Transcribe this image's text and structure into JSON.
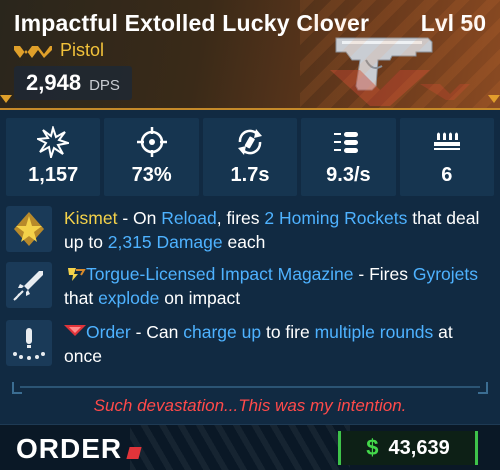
{
  "item": {
    "name": "Impactful Extolled Lucky Clover",
    "level": "Lvl 50",
    "weapon_type": "Pistol",
    "dps_value": "2,948",
    "dps_label": "DPS",
    "rarity_color": "#e0a02a"
  },
  "stats": [
    {
      "icon": "damage-burst-icon",
      "value": "1,157"
    },
    {
      "icon": "crosshair-accuracy-icon",
      "value": "73%"
    },
    {
      "icon": "reload-icon",
      "value": "1.7s"
    },
    {
      "icon": "fire-rate-bullets-icon",
      "value": "9.3/s"
    },
    {
      "icon": "magazine-icon",
      "value": "6"
    }
  ],
  "perks": [
    {
      "icon": "kismet-star-icon",
      "segments": [
        {
          "text": "Kismet",
          "style": "yellow"
        },
        {
          "text": " - On ",
          "style": "white"
        },
        {
          "text": "Reload",
          "style": "blue"
        },
        {
          "text": ", fires ",
          "style": "white"
        },
        {
          "text": "2 Homing Rockets",
          "style": "blue"
        },
        {
          "text": " that deal up to ",
          "style": "white"
        },
        {
          "text": "2,315 Damage",
          "style": "blue"
        },
        {
          "text": " each",
          "style": "white"
        }
      ]
    },
    {
      "icon": "rocket-icon",
      "badge_icon": "torgue-badge-icon",
      "segments": [
        {
          "text": "Torgue-Licensed Impact Magazine",
          "style": "blue"
        },
        {
          "text": " - Fires ",
          "style": "white"
        },
        {
          "text": "Gyrojets",
          "style": "blue"
        },
        {
          "text": " that ",
          "style": "white"
        },
        {
          "text": "explode",
          "style": "blue"
        },
        {
          "text": " on impact",
          "style": "white"
        }
      ]
    },
    {
      "icon": "order-charge-icon",
      "badge_icon": "order-badge-icon",
      "segments": [
        {
          "text": "Order",
          "style": "blue"
        },
        {
          "text": " - Can ",
          "style": "white"
        },
        {
          "text": "charge up",
          "style": "blue"
        },
        {
          "text": " to fire ",
          "style": "white"
        },
        {
          "text": "multiple rounds",
          "style": "blue"
        },
        {
          "text": " at once",
          "style": "white"
        }
      ]
    }
  ],
  "flavor_text": "Such devastation...This was my intention.",
  "footer": {
    "manufacturer": "ORDER",
    "price_icon": "$",
    "price": "43,639"
  },
  "colors": {
    "yellow": "#f4d24a",
    "blue": "#4eb2ff",
    "red": "#ff4a4a",
    "money_green": "#43d84a"
  }
}
